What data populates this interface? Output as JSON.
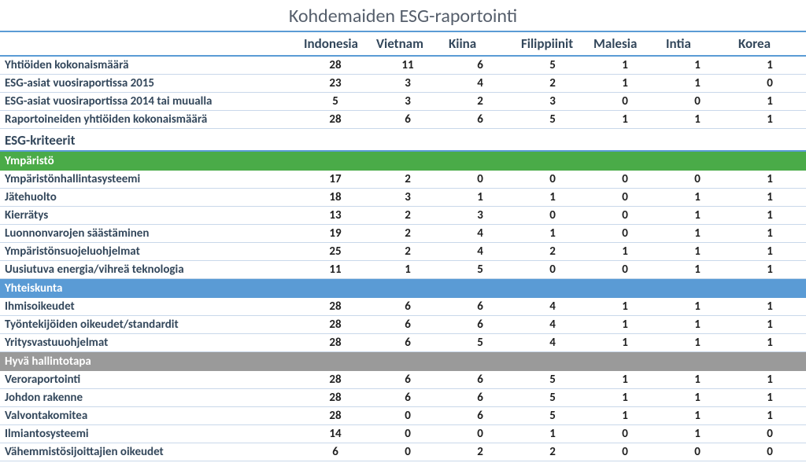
{
  "title": "Kohdemaiden ESG-raportointi",
  "columns": [
    "Indonesia",
    "Vietnam",
    "Kiina",
    "Filippiinit",
    "Malesia",
    "Intia",
    "Korea"
  ],
  "top_rows": [
    {
      "label": "Yhtiöiden kokonaismäärä",
      "vals": [
        28,
        11,
        6,
        5,
        1,
        1,
        1
      ]
    },
    {
      "label": "ESG-asiat vuosiraportissa 2015",
      "vals": [
        23,
        3,
        4,
        2,
        1,
        1,
        0
      ]
    },
    {
      "label": "ESG-asiat vuosiraportissa 2014 tai muualla",
      "vals": [
        5,
        3,
        2,
        3,
        0,
        0,
        1
      ]
    },
    {
      "label": "Raportoineiden yhtiöiden kokonaismäärä",
      "vals": [
        28,
        6,
        6,
        5,
        1,
        1,
        1
      ]
    }
  ],
  "criteria_label": "ESG-kriteerit",
  "sections": [
    {
      "name": "Ympäristö",
      "class": "cat-green",
      "rows": [
        {
          "label": "Ympäristönhallintasysteemi",
          "vals": [
            17,
            2,
            0,
            0,
            0,
            0,
            1
          ]
        },
        {
          "label": "Jätehuolto",
          "vals": [
            18,
            3,
            1,
            1,
            0,
            1,
            1
          ]
        },
        {
          "label": "Kierrätys",
          "vals": [
            13,
            2,
            3,
            0,
            0,
            1,
            1
          ]
        },
        {
          "label": "Luonnonvarojen säästäminen",
          "vals": [
            19,
            2,
            4,
            1,
            0,
            1,
            1
          ]
        },
        {
          "label": "Ympäristönsuojeluohjelmat",
          "vals": [
            25,
            2,
            4,
            2,
            1,
            1,
            1
          ]
        },
        {
          "label": "Uusiutuva energia/vihreä teknologia",
          "vals": [
            11,
            1,
            5,
            0,
            0,
            1,
            1
          ]
        }
      ]
    },
    {
      "name": "Yhteiskunta",
      "class": "cat-blue",
      "rows": [
        {
          "label": "Ihmisoikeudet",
          "vals": [
            28,
            6,
            6,
            4,
            1,
            1,
            1
          ]
        },
        {
          "label": "Työntekijöiden oikeudet/standardit",
          "vals": [
            28,
            6,
            6,
            4,
            1,
            1,
            1
          ]
        },
        {
          "label": "Yritysvastuuohjelmat",
          "vals": [
            28,
            6,
            5,
            4,
            1,
            1,
            1
          ]
        }
      ]
    },
    {
      "name": "Hyvä hallintotapa",
      "class": "cat-grey",
      "rows": [
        {
          "label": "Veroraportointi",
          "vals": [
            28,
            6,
            6,
            5,
            1,
            1,
            1
          ]
        },
        {
          "label": "Johdon rakenne",
          "vals": [
            28,
            6,
            6,
            5,
            1,
            1,
            1
          ]
        },
        {
          "label": "Valvontakomitea",
          "vals": [
            28,
            0,
            6,
            5,
            1,
            1,
            1
          ]
        },
        {
          "label": "Ilmiantosysteemi",
          "vals": [
            14,
            0,
            0,
            1,
            0,
            1,
            0
          ]
        },
        {
          "label": "Vähemmistösijoittajien oikeudet",
          "vals": [
            6,
            0,
            2,
            2,
            0,
            0,
            0
          ]
        }
      ]
    }
  ],
  "chart_data": {
    "type": "table",
    "title": "Kohdemaiden ESG-raportointi",
    "columns": [
      "Indonesia",
      "Vietnam",
      "Kiina",
      "Filippiinit",
      "Malesia",
      "Intia",
      "Korea"
    ],
    "rows": [
      {
        "label": "Yhtiöiden kokonaismäärä",
        "values": [
          28,
          11,
          6,
          5,
          1,
          1,
          1
        ]
      },
      {
        "label": "ESG-asiat vuosiraportissa 2015",
        "values": [
          23,
          3,
          4,
          2,
          1,
          1,
          0
        ]
      },
      {
        "label": "ESG-asiat vuosiraportissa 2014 tai muualla",
        "values": [
          5,
          3,
          2,
          3,
          0,
          0,
          1
        ]
      },
      {
        "label": "Raportoineiden yhtiöiden kokonaismäärä",
        "values": [
          28,
          6,
          6,
          5,
          1,
          1,
          1
        ]
      },
      {
        "label": "Ympäristönhallintasysteemi",
        "values": [
          17,
          2,
          0,
          0,
          0,
          0,
          1
        ]
      },
      {
        "label": "Jätehuolto",
        "values": [
          18,
          3,
          1,
          1,
          0,
          1,
          1
        ]
      },
      {
        "label": "Kierrätys",
        "values": [
          13,
          2,
          3,
          0,
          0,
          1,
          1
        ]
      },
      {
        "label": "Luonnonvarojen säästäminen",
        "values": [
          19,
          2,
          4,
          1,
          0,
          1,
          1
        ]
      },
      {
        "label": "Ympäristönsuojeluohjelmat",
        "values": [
          25,
          2,
          4,
          2,
          1,
          1,
          1
        ]
      },
      {
        "label": "Uusiutuva energia/vihreä teknologia",
        "values": [
          11,
          1,
          5,
          0,
          0,
          1,
          1
        ]
      },
      {
        "label": "Ihmisoikeudet",
        "values": [
          28,
          6,
          6,
          4,
          1,
          1,
          1
        ]
      },
      {
        "label": "Työntekijöiden oikeudet/standardit",
        "values": [
          28,
          6,
          6,
          4,
          1,
          1,
          1
        ]
      },
      {
        "label": "Yritysvastuuohjelmat",
        "values": [
          28,
          6,
          5,
          4,
          1,
          1,
          1
        ]
      },
      {
        "label": "Veroraportointi",
        "values": [
          28,
          6,
          6,
          5,
          1,
          1,
          1
        ]
      },
      {
        "label": "Johdon rakenne",
        "values": [
          28,
          6,
          6,
          5,
          1,
          1,
          1
        ]
      },
      {
        "label": "Valvontakomitea",
        "values": [
          28,
          0,
          6,
          5,
          1,
          1,
          1
        ]
      },
      {
        "label": "Ilmiantosysteemi",
        "values": [
          14,
          0,
          0,
          1,
          0,
          1,
          0
        ]
      },
      {
        "label": "Vähemmistösijoittajien oikeudet",
        "values": [
          6,
          0,
          2,
          2,
          0,
          0,
          0
        ]
      }
    ]
  }
}
